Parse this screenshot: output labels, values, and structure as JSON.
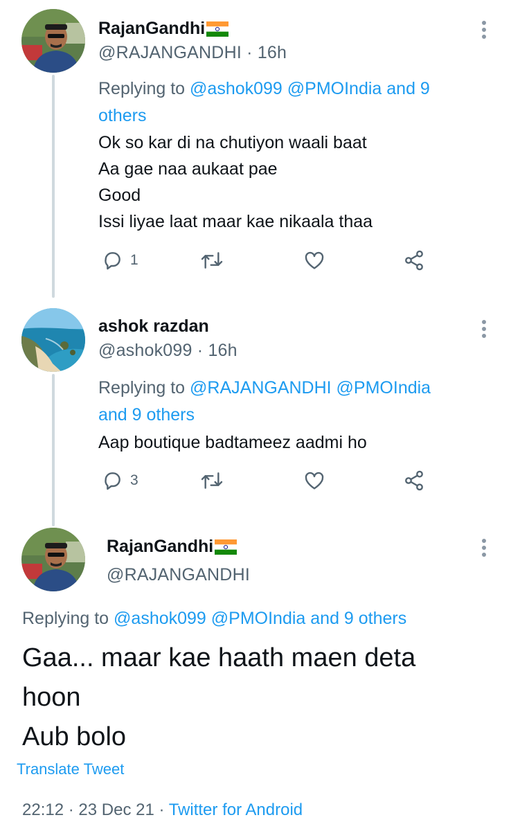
{
  "tweets": [
    {
      "name": "RajanGandhi",
      "handle": "@RAJANGANDHI",
      "sep": "·",
      "time": "16h",
      "replying_prefix": "Replying to",
      "replying_targets_line1": "@ashok099 @PMOIndia and 9",
      "replying_targets_line2": "others",
      "text": "Ok so kar di na chutiyon waali baat\nAa gae naa aukaat pae\nGood\nIssi liyae laat maar kae nikaala thaa",
      "reply_count": "1"
    },
    {
      "name": "ashok razdan",
      "handle": "@ashok099",
      "sep": "·",
      "time": "16h",
      "replying_prefix": "Replying to",
      "replying_targets_line1": "@RAJANGANDHI @PMOIndia",
      "replying_targets_line2": "and 9 others",
      "text": "Aap boutique badtameez aadmi ho",
      "reply_count": "3"
    }
  ],
  "main_tweet": {
    "name": "RajanGandhi",
    "handle": "@RAJANGANDHI",
    "replying_prefix": "Replying to",
    "replying_targets": "@ashok099 @PMOIndia and 9 others",
    "text": "Gaa... maar kae haath maen deta\nhoon\nAub bolo",
    "translate_label": "Translate Tweet",
    "time": "22:12",
    "sep1": "·",
    "date": "23 Dec 21",
    "sep2": "·",
    "source": "Twitter for Android"
  },
  "icons": {
    "reply": "reply-icon",
    "retweet": "retweet-icon",
    "like": "heart-icon",
    "share": "share-icon",
    "more": "more-vertical-icon"
  },
  "colors": {
    "link": "#1d9bf0",
    "secondary_text": "#536471",
    "primary_text": "#0f1419",
    "thread_line": "#cfd9de",
    "icon": "#536471"
  }
}
